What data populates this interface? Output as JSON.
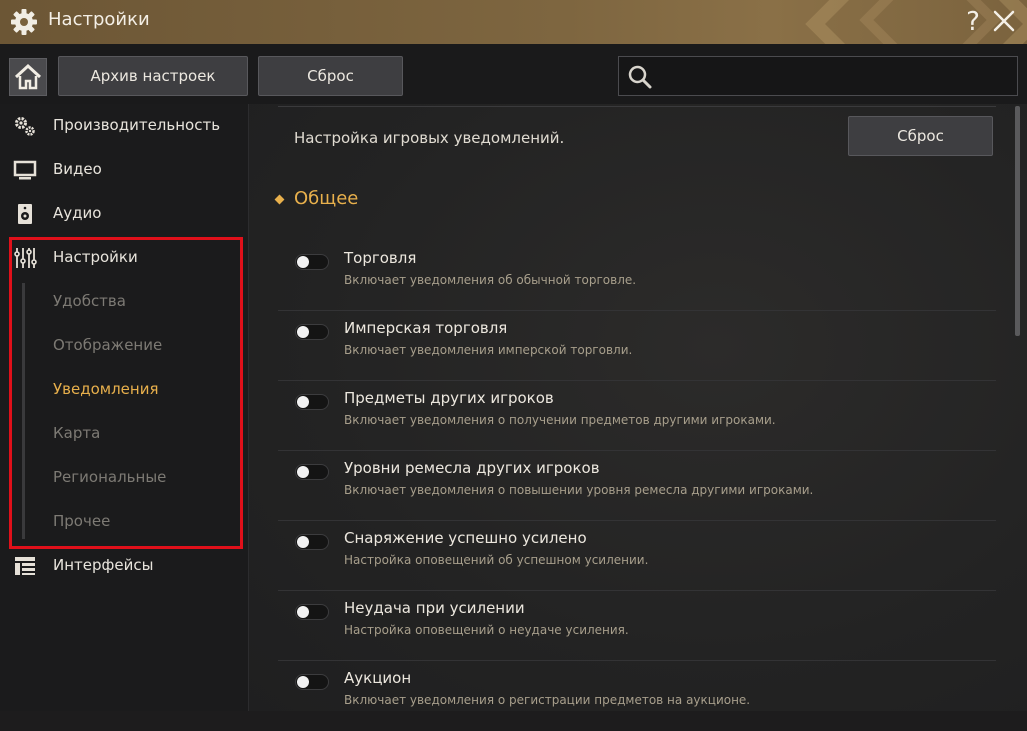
{
  "window": {
    "title": "Настройки",
    "icon": "gear-icon",
    "help_label": "?",
    "close_label": "×"
  },
  "toolbar": {
    "home_icon": "home-icon",
    "archive_label": "Архив настроек",
    "reset_label": "Сброс",
    "search": {
      "value": "",
      "placeholder": ""
    }
  },
  "sidebar": {
    "items": [
      {
        "label": "Производительность",
        "icon": "performance-gears-icon"
      },
      {
        "label": "Видео",
        "icon": "monitor-icon"
      },
      {
        "label": "Аудио",
        "icon": "speaker-icon"
      },
      {
        "label": "Настройки",
        "icon": "sliders-icon"
      },
      {
        "label": "Интерфейсы",
        "icon": "interface-layout-icon"
      }
    ],
    "subitems": [
      {
        "label": "Удобства",
        "active": false
      },
      {
        "label": "Отображение",
        "active": false
      },
      {
        "label": "Уведомления",
        "active": true
      },
      {
        "label": "Карта",
        "active": false
      },
      {
        "label": "Региональные",
        "active": false
      },
      {
        "label": "Прочее",
        "active": false
      }
    ]
  },
  "content": {
    "info": "Настройка игровых уведомлений.",
    "reset_label": "Сброс",
    "section_title": "Общее",
    "rows": [
      {
        "title": "Торговля",
        "desc": "Включает уведомления об обычной торговле.",
        "enabled": false
      },
      {
        "title": "Имперская торговля",
        "desc": "Включает уведомления имперской торговли.",
        "enabled": false
      },
      {
        "title": "Предметы других игроков",
        "desc": "Включает уведомления о получении предметов другими игроками.",
        "enabled": false
      },
      {
        "title": "Уровни ремесла других игроков",
        "desc": "Включает уведомления о повышении уровня ремесла другими игроками.",
        "enabled": false
      },
      {
        "title": "Снаряжение успешно усилено",
        "desc": "Настройка оповещений об успешном усилении.",
        "enabled": false
      },
      {
        "title": "Неудача при усилении",
        "desc": "Настройка оповещений о неудаче усиления.",
        "enabled": false
      },
      {
        "title": "Аукцион",
        "desc": "Включает уведомления о регистрации предметов на аукционе.",
        "enabled": false
      }
    ]
  },
  "colors": {
    "accent": "#e8b04c",
    "highlight_box": "#e0101a",
    "titlebar": "#7e6640"
  }
}
